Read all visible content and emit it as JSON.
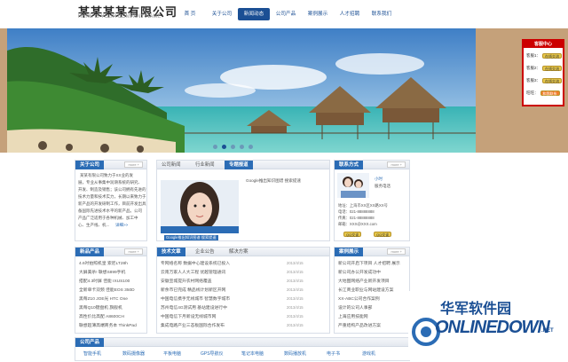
{
  "header": {
    "company": "某某某某有限公司",
    "slogan": "HERE IS YOUR COMPANY NAME"
  },
  "nav": [
    "首 页",
    "关于公司",
    "新闻动态",
    "公司产品",
    "案例展示",
    "人才招聘",
    "联系我们"
  ],
  "nav_active": 2,
  "support": {
    "title": "客服中心",
    "rows": [
      {
        "label": "客服1：",
        "btn": "在线交流"
      },
      {
        "label": "客服2：",
        "btn": "在线交流"
      },
      {
        "label": "客服3：",
        "btn": "在线交流"
      },
      {
        "label": "旺旺：",
        "btn": "和我联系"
      }
    ]
  },
  "about": {
    "title": "关于公司",
    "more": "more +",
    "text": [
      "某某有限公司致力于XX业的发",
      "展，专业从事集中润滑系统的研究、",
      "开发、制造及销售；该公司拥有先进的",
      "技术力量和技术实力，长期以来致力于",
      "新产品的开发研制工作，目前开发出具",
      "备国际先进技术水平的新产品。公司",
      "产品广泛适用于各种机械、加工中",
      "心、生产线、机..."
    ],
    "link": "详细>>"
  },
  "news": {
    "tabs": [
      "公司新闻",
      "行业新闻",
      "专题报道"
    ],
    "active": 2,
    "photo_caption": "Google推出知识图谱 搜索提速",
    "first": "Google推出知识图谱 搜索提速"
  },
  "contact": {
    "title": "联系方式",
    "more": "more +",
    "lines": [
      "地址：上海市XX区XX路XX号",
      "电话：021-88888888",
      "传真：021-88888888",
      "邮箱：XXX@XXX.com"
    ],
    "qq": [
      "QQ交谈",
      "QQ交谈"
    ],
    "hotline": "小时",
    "hotline2": "服务电话"
  },
  "products": {
    "title": "新品产品",
    "more": "more +",
    "items": [
      "4.6吋拍照机皇 索尼LT28h",
      "大屏美杀! 联想S899手机",
      "搭配4.3吋屏 佳能 IXUS100",
      "全新单卡双频 佳能EOS 350D",
      "黑莓Z10 JOE光 HTC One",
      "黑莓Q10键盘机 旗舰机",
      "高性价比高配 A8600CH",
      "联想超薄高端商务本 ThinkPad"
    ]
  },
  "tech": {
    "tabs": [
      "技术文章",
      "企业公告",
      "解决方案"
    ],
    "active": 0,
    "items": [
      "专网络名称 数据中心建设系统已投入",
      "云南万家人人大工程 优越管理通讯",
      "安徽宣城提升农村网络覆盖",
      "新余市已完成 精品线计划新区开网",
      "中国电信携手无线城市 智慧数字城市",
      "苏州电信4G测试用 基站建设进行中",
      "中国电信下月新设无线城市网",
      "集成电路产业三态板国际合作发布"
    ],
    "dates": [
      "2013/4/15",
      "2013/4/15",
      "2013/4/15",
      "2013/4/15",
      "2013/4/15",
      "2013/4/15",
      "2013/4/15",
      "2013/4/15"
    ]
  },
  "cases": {
    "title": "案例展示",
    "more": "more +",
    "items": [
      "新公司开启下项目 人才招聘 展示",
      "新公司办公开发成功中",
      "大地图网络产业新开发项目",
      "长江商业职业与网站建设方案",
      "XX-ABC公司合作案例",
      "设计的公司人事部",
      "上海应用技能网",
      "严重结构产品改进方案"
    ]
  },
  "footer": {
    "title": "公司产品",
    "items": [
      "智能手机",
      "数码摄像器",
      "平板电脑",
      "GPS导航仪",
      "笔记本电脑",
      "数码播放机",
      "电子书",
      "游戏机"
    ]
  },
  "watermark": {
    "cn": "华军软件园",
    "en": "ONLINEDOWN",
    "suffix": ".NET"
  }
}
